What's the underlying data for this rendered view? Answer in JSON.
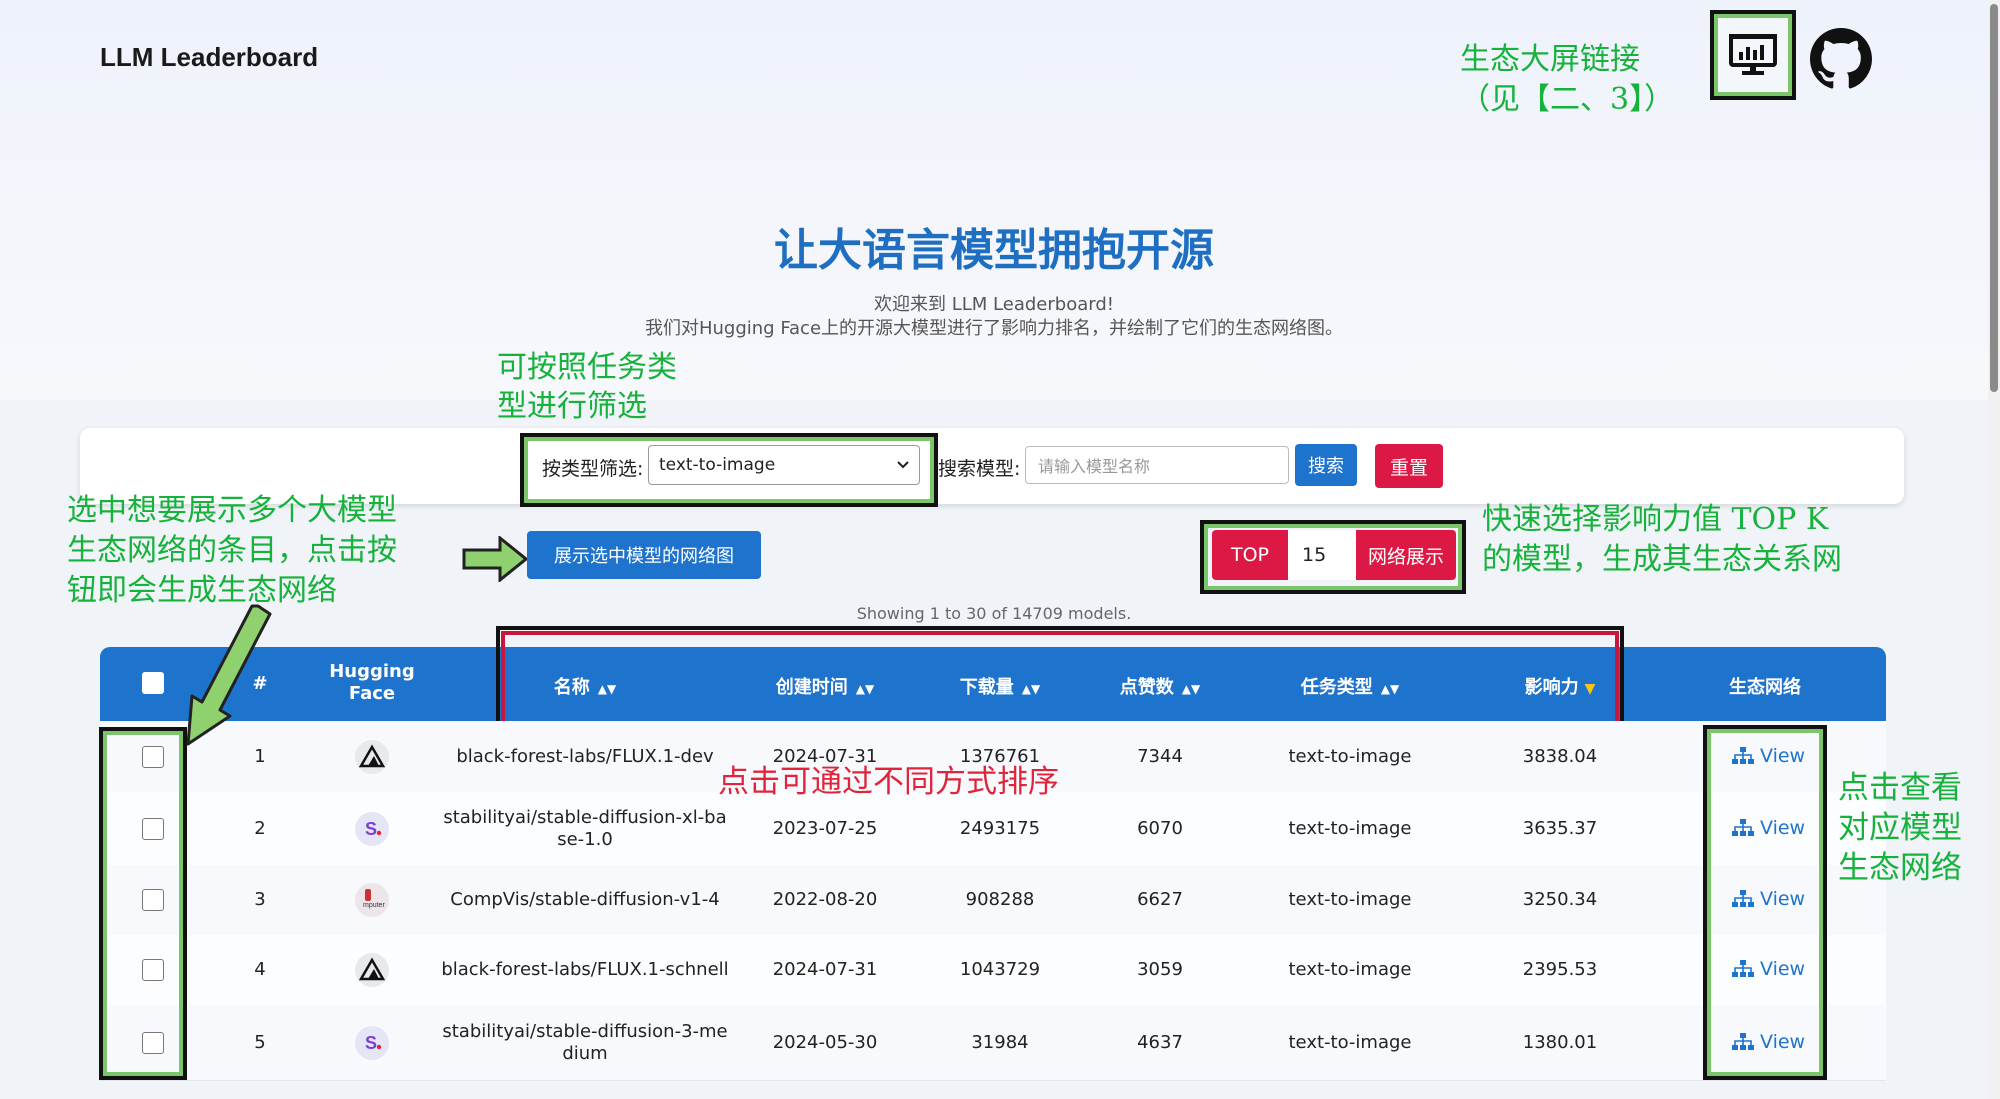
{
  "app": {
    "brand": "LLM Leaderboard"
  },
  "annotations": {
    "eco_link": "生态大屏链接\n（见【二、3】）",
    "filter": "可按照任务类\n型进行筛选",
    "select_entries": "选中想要展示多个大模型\n生态网络的条目，点击按\n钮即会生成生态网络",
    "topk": "快速选择影响力值 TOP K\n的模型，生成其生态关系网",
    "sort": "点击可通过不同方式排序",
    "view": "点击查看\n对应模型\n生态网络"
  },
  "hero": {
    "title": "让大语言模型拥抱开源",
    "subtitle1": "欢迎来到 LLM Leaderboard!",
    "subtitle2": "我们对Hugging Face上的开源大模型进行了影响力排名，并绘制了它们的生态网络图。"
  },
  "filter": {
    "type_label": "按类型筛选:",
    "type_value": "text-to-image",
    "search_label": "搜索模型:",
    "search_placeholder": "请输入模型名称",
    "search_button": "搜索",
    "reset_button": "重置"
  },
  "actions": {
    "show_selected": "展示选中模型的网络图",
    "top_label": "TOP",
    "top_value": "15",
    "network_button": "网络展示"
  },
  "table": {
    "showing": "Showing 1 to 30 of 14709 models.",
    "headers": {
      "index": "#",
      "hf": "Hugging Face",
      "name": "名称",
      "created": "创建时间",
      "downloads": "下载量",
      "likes": "点赞数",
      "task": "任务类型",
      "influence": "影响力",
      "eco": "生态网络"
    },
    "view_label": "View",
    "rows": [
      {
        "index": "1",
        "logo": "blackforest-icon",
        "name": "black-forest-labs/FLUX.1-dev",
        "created": "2024-07-31",
        "downloads": "1376761",
        "likes": "7344",
        "task": "text-to-image",
        "influence": "3838.04"
      },
      {
        "index": "2",
        "logo": "stability-icon",
        "name": "stabilityai/stable-diffusion-xl-base-1.0",
        "created": "2023-07-25",
        "downloads": "2493175",
        "likes": "6070",
        "task": "text-to-image",
        "influence": "3635.37"
      },
      {
        "index": "3",
        "logo": "compvis-icon",
        "name": "CompVis/stable-diffusion-v1-4",
        "created": "2022-08-20",
        "downloads": "908288",
        "likes": "6627",
        "task": "text-to-image",
        "influence": "3250.34"
      },
      {
        "index": "4",
        "logo": "blackforest-icon",
        "name": "black-forest-labs/FLUX.1-schnell",
        "created": "2024-07-31",
        "downloads": "1043729",
        "likes": "3059",
        "task": "text-to-image",
        "influence": "2395.53"
      },
      {
        "index": "5",
        "logo": "stability-icon",
        "name": "stabilityai/stable-diffusion-3-medium",
        "created": "2024-05-30",
        "downloads": "31984",
        "likes": "4637",
        "task": "text-to-image",
        "influence": "1380.01"
      }
    ]
  },
  "colors": {
    "primary": "#1e73cc",
    "danger": "#dc1845",
    "annotation_green": "#17b23c",
    "annotation_red": "#e0253a"
  }
}
